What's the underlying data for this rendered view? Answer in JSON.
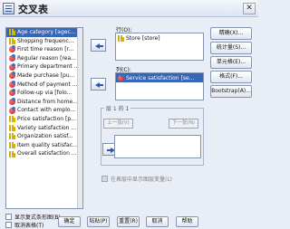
{
  "window": {
    "title": "交叉表"
  },
  "variables": [
    "Age category [agec...",
    "Shopping frequenc...",
    "First time reason [r...",
    "Regular reason [rea...",
    "Primary department ...",
    "Made purchase [pu...",
    "Method of payment ...",
    "Follow-up via [folo...",
    "Distance from home...",
    "Contact with emplo...",
    "Price satisfaction [p...",
    "Variety satisfaction ...",
    "Organization satisf...",
    "Item quality satisfac...",
    "Overall satisfaction ..."
  ],
  "rows": {
    "label": "行(O):",
    "items": [
      "Store [store]"
    ]
  },
  "columns": {
    "label": "列(C):",
    "items": [
      "Service satisfaction [se..."
    ]
  },
  "layer": {
    "title": "层 1 的 1",
    "prev": "上一张(V)",
    "next": "下一张(N)"
  },
  "layer_display_checkbox": "在表层中显示图层变量(L)",
  "side_buttons": [
    "精确(X)...",
    "统计量(S)...",
    "单元格(E)...",
    "格式(F)...",
    "Bootstrap(A)..."
  ],
  "checkboxes": {
    "clustered_bar": "显示复式条形图(B)",
    "suppress_tables": "取消表格(T)"
  },
  "bottom_buttons": [
    "确定",
    "粘贴(P)",
    "重置(R)",
    "取消",
    "帮助"
  ]
}
